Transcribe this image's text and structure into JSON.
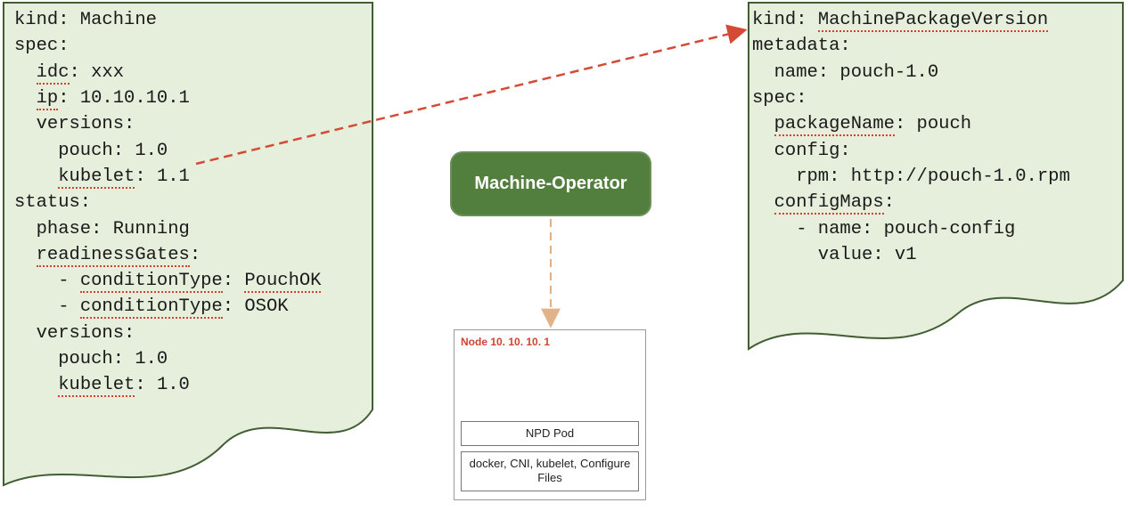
{
  "operator": {
    "label": "Machine-Operator"
  },
  "node": {
    "title": "Node  10. 10. 10. 1",
    "pod_label": "NPD Pod",
    "components_label": "docker, CNI, kubelet, Configure Files"
  },
  "machine_yaml": {
    "l1": "kind: Machine",
    "l2": "spec:",
    "l3a": "  ",
    "l3b": "idc",
    "l3c": ": xxx",
    "l4a": "  ",
    "l4b": "ip",
    "l4c": ": 10.10.10.1",
    "l5": "  versions:",
    "l6": "    pouch: 1.0",
    "l7a": "    ",
    "l7b": "kubelet",
    "l7c": ": 1.1",
    "l8": "status:",
    "l9": "  phase: Running",
    "l10a": "  ",
    "l10b": "readinessGates",
    "l10c": ":",
    "l11a": "    - ",
    "l11b": "conditionType",
    "l11c": ": ",
    "l11d": "PouchOK",
    "l12a": "    - ",
    "l12b": "conditionType",
    "l12c": ": OSOK",
    "l13": "  versions:",
    "l14": "    pouch: 1.0",
    "l15a": "    ",
    "l15b": "kubelet",
    "l15c": ": 1.0"
  },
  "mpv_yaml": {
    "l1": "kind: ",
    "l1u": "MachinePackageVersion",
    "l2": "metadata:",
    "l3": "  name: pouch-1.0",
    "l4": "spec:",
    "l5a": "  ",
    "l5b": "packageName",
    "l5c": ": pouch",
    "l6": "  config:",
    "l7": "    rpm: http://pouch-1.0.rpm",
    "l8a": "  ",
    "l8b": "configMaps",
    "l8c": ":",
    "l9": "    - name: pouch-config",
    "l10": "      value: v1"
  }
}
